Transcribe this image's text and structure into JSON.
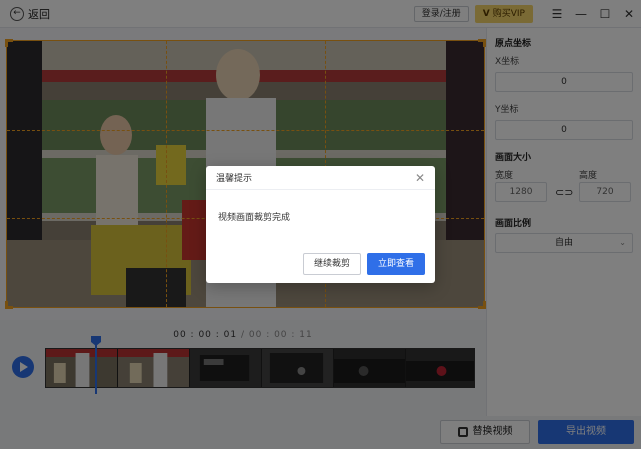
{
  "titlebar": {
    "back_label": "返回",
    "login_label": "登录/注册",
    "vip_label": "购买VIP",
    "vip_badge": "V",
    "menu_glyph": "☰",
    "minimize_glyph": "—",
    "maximize_glyph": "☐",
    "close_glyph": "✕"
  },
  "panel": {
    "origin_title": "原点坐标",
    "x_label": "X坐标",
    "x_value": "0",
    "y_label": "Y坐标",
    "y_value": "0",
    "size_title": "画面大小",
    "width_label": "宽度",
    "width_value": "1280",
    "height_label": "高度",
    "height_value": "720",
    "link_glyph": "⊂⊃",
    "ratio_title": "画面比例",
    "ratio_value": "自由"
  },
  "timeline": {
    "current_time": "00 : 00 : 01",
    "separator": " / ",
    "total_time": "00 : 00 : 11"
  },
  "buttons": {
    "replace_video": "替换视频",
    "export_video": "导出视频"
  },
  "modal": {
    "title": "温馨提示",
    "message": "视频画面裁剪完成",
    "continue_label": "继续裁剪",
    "view_label": "立即查看"
  },
  "colors": {
    "accent": "#2f6fe8",
    "crop_frame": "#f0a020",
    "vip": "#f4d46a"
  },
  "icons": {
    "back": "back-arrow-icon",
    "menu": "hamburger-menu-icon",
    "link": "chain-link-icon",
    "play": "play-icon",
    "close": "close-icon"
  }
}
